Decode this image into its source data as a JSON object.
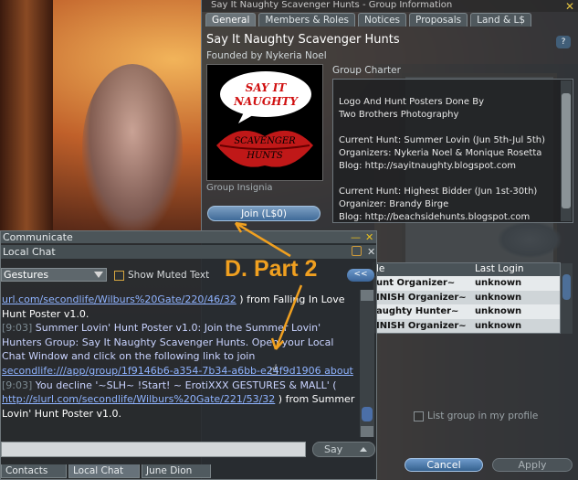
{
  "group_window": {
    "title": "Say It Naughty Scavenger Hunts - Group Information",
    "tabs": [
      "General",
      "Members & Roles",
      "Notices",
      "Proposals",
      "Land & L$"
    ],
    "group_name": "Say It Naughty Scavenger Hunts",
    "founded_by": "Founded by Nykeria Noel",
    "insignia_label": "Group Insignia",
    "insignia_text": [
      "SAY IT",
      "NAUGHTY",
      "SCAVENGER",
      "HUNTS"
    ],
    "join_button": "Join (L$0)",
    "help_label": "?",
    "charter_label": "Group Charter",
    "charter_text": "Logo And Hunt Posters Done By\n     Two Brothers Photography\n\nCurrent Hunt: Summer Lovin (Jun 5th-Jul 5th)\nOrganizers: Nykeria Noel & Monique Rosetta\nBlog: http://sayitnaughty.blogspot.com\n\nCurrent Hunt: Highest Bidder (Jun 1st-30th)\nOrganizer: Brandy Birge\nBlog: http://beachsidehunts.blogspot.com",
    "members": {
      "columns": [
        "Title",
        "Last Login"
      ],
      "col1_visible": "le",
      "rows": [
        {
          "title": "unt Organizer~",
          "last_login": "unknown"
        },
        {
          "title": "INISH Organizer~",
          "last_login": "unknown"
        },
        {
          "title": "aughty Hunter~",
          "last_login": "unknown"
        },
        {
          "title": "INISH Organizer~",
          "last_login": "unknown"
        }
      ]
    },
    "list_in_profile": "List group in my profile",
    "cancel_button": "Cancel",
    "apply_button": "Apply"
  },
  "chat_window": {
    "title": "Communicate",
    "subtitle": "Local Chat",
    "gestures": "Gestures",
    "show_muted": "Show Muted Text",
    "nav_button": "<<",
    "say_button": "Say",
    "messages": {
      "m1_link": "url.com/secondlife/Wilburs%20Gate/220/46/32",
      "m1_text": " ) from Falling In Love Hunt Poster v1.0.",
      "m2_ts": "[9:03]",
      "m2_text": " Summer Lovin' Hunt Poster v1.0: Join the Summer Lovin' Hunters Group: Say It Naughty Scavenger Hunts. Open your Local Chat Window and click on the following link to join ",
      "m2_link": "secondlife:///app/group/1f9146b6-a354-7b34-a6bb-e24f9d1906 ",
      "m2_link_tail": "about",
      "m3_ts": "[9:03]",
      "m3_text": " You decline '~SLH~ !Start! ~ ErotiXXX  GESTURES & MALL' ( ",
      "m3_link": "http://slurl.com/secondlife/Wilburs%20Gate/221/53/32",
      "m3_tail": " ) from Summer Lovin' Hunt Poster v1.0."
    },
    "bottom_tabs": [
      "Contacts",
      "Local Chat",
      "June Dion"
    ]
  },
  "annotation": "D. Part 2",
  "colors": {
    "accent_orange": "#f0a020",
    "link": "#8fb3ff",
    "timestamp": "#7c8a92"
  }
}
